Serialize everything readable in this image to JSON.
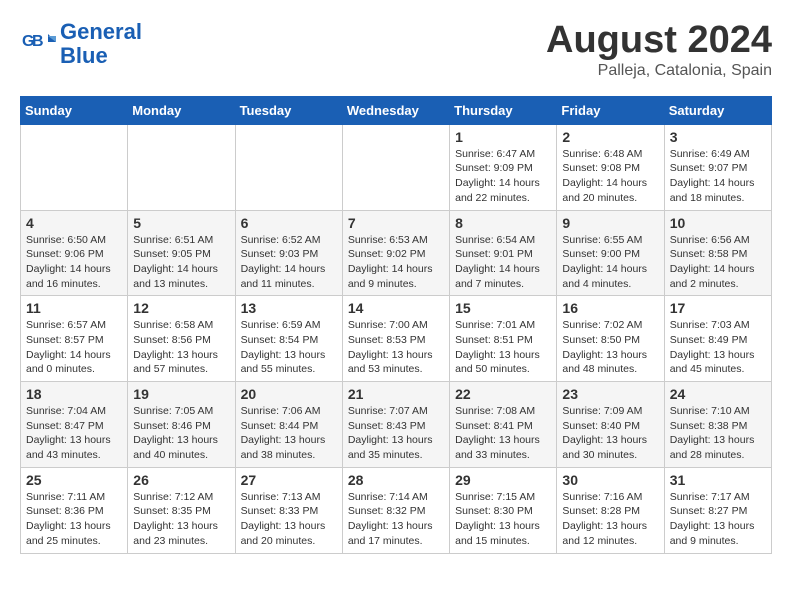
{
  "header": {
    "logo_line1": "General",
    "logo_line2": "Blue",
    "month": "August 2024",
    "location": "Palleja, Catalonia, Spain"
  },
  "weekdays": [
    "Sunday",
    "Monday",
    "Tuesday",
    "Wednesday",
    "Thursday",
    "Friday",
    "Saturday"
  ],
  "weeks": [
    [
      {
        "num": "",
        "info": ""
      },
      {
        "num": "",
        "info": ""
      },
      {
        "num": "",
        "info": ""
      },
      {
        "num": "",
        "info": ""
      },
      {
        "num": "1",
        "info": "Sunrise: 6:47 AM\nSunset: 9:09 PM\nDaylight: 14 hours\nand 22 minutes."
      },
      {
        "num": "2",
        "info": "Sunrise: 6:48 AM\nSunset: 9:08 PM\nDaylight: 14 hours\nand 20 minutes."
      },
      {
        "num": "3",
        "info": "Sunrise: 6:49 AM\nSunset: 9:07 PM\nDaylight: 14 hours\nand 18 minutes."
      }
    ],
    [
      {
        "num": "4",
        "info": "Sunrise: 6:50 AM\nSunset: 9:06 PM\nDaylight: 14 hours\nand 16 minutes."
      },
      {
        "num": "5",
        "info": "Sunrise: 6:51 AM\nSunset: 9:05 PM\nDaylight: 14 hours\nand 13 minutes."
      },
      {
        "num": "6",
        "info": "Sunrise: 6:52 AM\nSunset: 9:03 PM\nDaylight: 14 hours\nand 11 minutes."
      },
      {
        "num": "7",
        "info": "Sunrise: 6:53 AM\nSunset: 9:02 PM\nDaylight: 14 hours\nand 9 minutes."
      },
      {
        "num": "8",
        "info": "Sunrise: 6:54 AM\nSunset: 9:01 PM\nDaylight: 14 hours\nand 7 minutes."
      },
      {
        "num": "9",
        "info": "Sunrise: 6:55 AM\nSunset: 9:00 PM\nDaylight: 14 hours\nand 4 minutes."
      },
      {
        "num": "10",
        "info": "Sunrise: 6:56 AM\nSunset: 8:58 PM\nDaylight: 14 hours\nand 2 minutes."
      }
    ],
    [
      {
        "num": "11",
        "info": "Sunrise: 6:57 AM\nSunset: 8:57 PM\nDaylight: 14 hours\nand 0 minutes."
      },
      {
        "num": "12",
        "info": "Sunrise: 6:58 AM\nSunset: 8:56 PM\nDaylight: 13 hours\nand 57 minutes."
      },
      {
        "num": "13",
        "info": "Sunrise: 6:59 AM\nSunset: 8:54 PM\nDaylight: 13 hours\nand 55 minutes."
      },
      {
        "num": "14",
        "info": "Sunrise: 7:00 AM\nSunset: 8:53 PM\nDaylight: 13 hours\nand 53 minutes."
      },
      {
        "num": "15",
        "info": "Sunrise: 7:01 AM\nSunset: 8:51 PM\nDaylight: 13 hours\nand 50 minutes."
      },
      {
        "num": "16",
        "info": "Sunrise: 7:02 AM\nSunset: 8:50 PM\nDaylight: 13 hours\nand 48 minutes."
      },
      {
        "num": "17",
        "info": "Sunrise: 7:03 AM\nSunset: 8:49 PM\nDaylight: 13 hours\nand 45 minutes."
      }
    ],
    [
      {
        "num": "18",
        "info": "Sunrise: 7:04 AM\nSunset: 8:47 PM\nDaylight: 13 hours\nand 43 minutes."
      },
      {
        "num": "19",
        "info": "Sunrise: 7:05 AM\nSunset: 8:46 PM\nDaylight: 13 hours\nand 40 minutes."
      },
      {
        "num": "20",
        "info": "Sunrise: 7:06 AM\nSunset: 8:44 PM\nDaylight: 13 hours\nand 38 minutes."
      },
      {
        "num": "21",
        "info": "Sunrise: 7:07 AM\nSunset: 8:43 PM\nDaylight: 13 hours\nand 35 minutes."
      },
      {
        "num": "22",
        "info": "Sunrise: 7:08 AM\nSunset: 8:41 PM\nDaylight: 13 hours\nand 33 minutes."
      },
      {
        "num": "23",
        "info": "Sunrise: 7:09 AM\nSunset: 8:40 PM\nDaylight: 13 hours\nand 30 minutes."
      },
      {
        "num": "24",
        "info": "Sunrise: 7:10 AM\nSunset: 8:38 PM\nDaylight: 13 hours\nand 28 minutes."
      }
    ],
    [
      {
        "num": "25",
        "info": "Sunrise: 7:11 AM\nSunset: 8:36 PM\nDaylight: 13 hours\nand 25 minutes."
      },
      {
        "num": "26",
        "info": "Sunrise: 7:12 AM\nSunset: 8:35 PM\nDaylight: 13 hours\nand 23 minutes."
      },
      {
        "num": "27",
        "info": "Sunrise: 7:13 AM\nSunset: 8:33 PM\nDaylight: 13 hours\nand 20 minutes."
      },
      {
        "num": "28",
        "info": "Sunrise: 7:14 AM\nSunset: 8:32 PM\nDaylight: 13 hours\nand 17 minutes."
      },
      {
        "num": "29",
        "info": "Sunrise: 7:15 AM\nSunset: 8:30 PM\nDaylight: 13 hours\nand 15 minutes."
      },
      {
        "num": "30",
        "info": "Sunrise: 7:16 AM\nSunset: 8:28 PM\nDaylight: 13 hours\nand 12 minutes."
      },
      {
        "num": "31",
        "info": "Sunrise: 7:17 AM\nSunset: 8:27 PM\nDaylight: 13 hours\nand 9 minutes."
      }
    ]
  ]
}
